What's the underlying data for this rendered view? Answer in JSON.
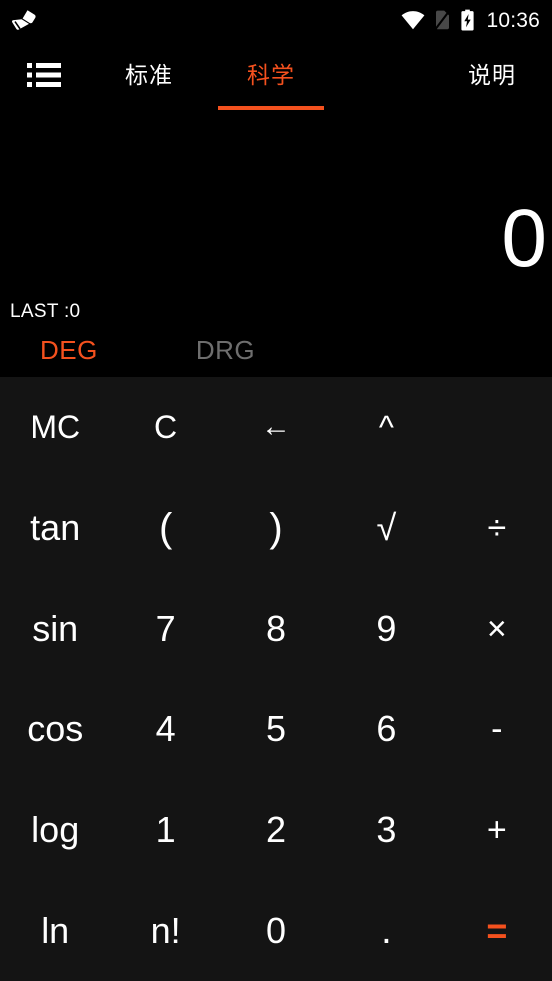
{
  "status_bar": {
    "left_icons": [
      {
        "name": "brush-icon"
      }
    ],
    "right_icons": [
      {
        "name": "wifi-icon"
      },
      {
        "name": "no-sim-icon"
      },
      {
        "name": "battery-charging-icon"
      }
    ],
    "time": "10:36"
  },
  "tab_bar": {
    "menu_icon": "list-menu-icon",
    "tabs": [
      {
        "label": "标准",
        "active": false
      },
      {
        "label": "科学",
        "active": true
      }
    ],
    "help_label": "说明",
    "accent_color": "#f4511e"
  },
  "display": {
    "main_value": "0",
    "last_label": "LAST :0",
    "modes": [
      {
        "label": "DEG",
        "active": true
      },
      {
        "label": "DRG",
        "active": false
      }
    ]
  },
  "keypad": {
    "rows": [
      [
        {
          "label": "MC",
          "kind": "func"
        },
        {
          "label": "C",
          "kind": "func"
        },
        {
          "label": "←",
          "kind": "back"
        },
        {
          "label": "^",
          "kind": "caret"
        }
      ],
      [
        {
          "label": "tan",
          "kind": "func"
        },
        {
          "label": "(",
          "kind": "paren"
        },
        {
          "label": ")",
          "kind": "paren"
        },
        {
          "label": "√",
          "kind": "sqrt"
        },
        {
          "label": "÷",
          "kind": "op"
        }
      ],
      [
        {
          "label": "sin",
          "kind": "func"
        },
        {
          "label": "7",
          "kind": "digit"
        },
        {
          "label": "8",
          "kind": "digit"
        },
        {
          "label": "9",
          "kind": "digit"
        },
        {
          "label": "×",
          "kind": "op"
        }
      ],
      [
        {
          "label": "cos",
          "kind": "func"
        },
        {
          "label": "4",
          "kind": "digit"
        },
        {
          "label": "5",
          "kind": "digit"
        },
        {
          "label": "6",
          "kind": "digit"
        },
        {
          "label": "-",
          "kind": "op"
        }
      ],
      [
        {
          "label": "log",
          "kind": "func"
        },
        {
          "label": "1",
          "kind": "digit"
        },
        {
          "label": "2",
          "kind": "digit"
        },
        {
          "label": "3",
          "kind": "digit"
        },
        {
          "label": "+",
          "kind": "op"
        }
      ],
      [
        {
          "label": "ln",
          "kind": "func"
        },
        {
          "label": "n!",
          "kind": "func"
        },
        {
          "label": "0",
          "kind": "digit"
        },
        {
          "label": ".",
          "kind": "dot"
        },
        {
          "label": "=",
          "kind": "equals"
        }
      ]
    ],
    "background_color": "#141414",
    "equals_color": "#f4511e"
  }
}
